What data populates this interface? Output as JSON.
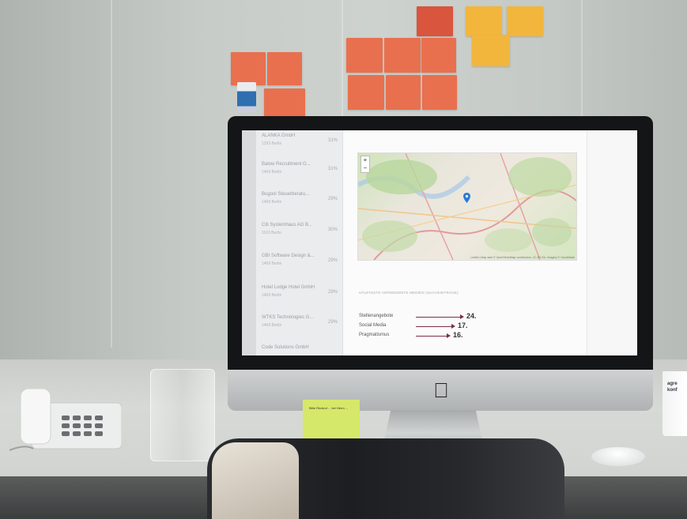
{
  "scene": {
    "description_icons": [
      "imac-monitor",
      "desk-phone",
      "water-glass",
      "sticky-note",
      "magic-mouse",
      "office-chair",
      "coffee-mug"
    ]
  },
  "screen": {
    "sidebar": {
      "items": [
        {
          "title": "ALANKA GmbH",
          "subtitle": "1293 Berlin",
          "pct": "31%"
        },
        {
          "title": "Balow Recruitment G...",
          "subtitle": "1469 Berlin",
          "pct": "31%"
        },
        {
          "title": "Bugool Steuerberatu...",
          "subtitle": "1469 Berlin",
          "pct": "29%"
        },
        {
          "title": "Citi Systemhaus AG B...",
          "subtitle": "1163 Berlin",
          "pct": "30%"
        },
        {
          "title": "GBI Software Design &...",
          "subtitle": "1469 Berlin",
          "pct": "29%"
        },
        {
          "title": "Hotel Lodge Hotel GmbH",
          "subtitle": "1469 Berlin",
          "pct": "29%"
        },
        {
          "title": "WTKS Technologies G...",
          "subtitle": "1469 Berlin",
          "pct": "29%"
        },
        {
          "title": "Code Solutions GmbH",
          "subtitle": "",
          "pct": ""
        }
      ]
    },
    "map": {
      "zoom_in": "+",
      "zoom_out": "−",
      "credit": "Leaflet | Map data © OpenStreetMap contributors, CC-BY-SA, Imagery © CloudMade"
    },
    "stats": {
      "heading": "HÄUFIGSTE VERWENDETE MEDIEN (SUCHEINTRÄGE)",
      "rows": [
        {
          "label": "Stellenangebote",
          "value": "24.",
          "fraction": 1.0
        },
        {
          "label": "Social Media",
          "value": "17.",
          "fraction": 0.8
        },
        {
          "label": "Pragmatismus",
          "value": "16.",
          "fraction": 0.7
        }
      ]
    }
  },
  "note": {
    "text": "Bitte Rückruf ... bei Herrn ..."
  },
  "mug": {
    "text": "agre\nkonf"
  },
  "colors": {
    "sticky_orange": "#e8704f",
    "sticky_yellow": "#f2b63c",
    "note_green": "#d6e86a",
    "bar_color": "#7a2f48"
  }
}
